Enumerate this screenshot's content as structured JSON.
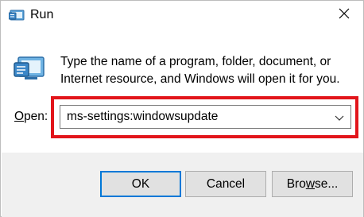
{
  "window": {
    "title": "Run",
    "icon": "run-icon",
    "close_icon": "close-icon"
  },
  "content": {
    "description_line1": "Type the name of a program, folder, document, or",
    "description_line2": "Internet resource, and Windows will open it for you.",
    "icon": "run-icon"
  },
  "open": {
    "label_accel": "O",
    "label_rest": "pen:",
    "value": "ms-settings:windowsupdate",
    "dropdown_icon": "chevron-down-icon"
  },
  "buttons": {
    "ok": "OK",
    "cancel": "Cancel",
    "browse_prefix": "Bro",
    "browse_accel": "w",
    "browse_suffix": "se..."
  },
  "colors": {
    "highlight": "#e2151b",
    "focus_border": "#0078d7",
    "footer_bg": "#f0f0f0"
  }
}
